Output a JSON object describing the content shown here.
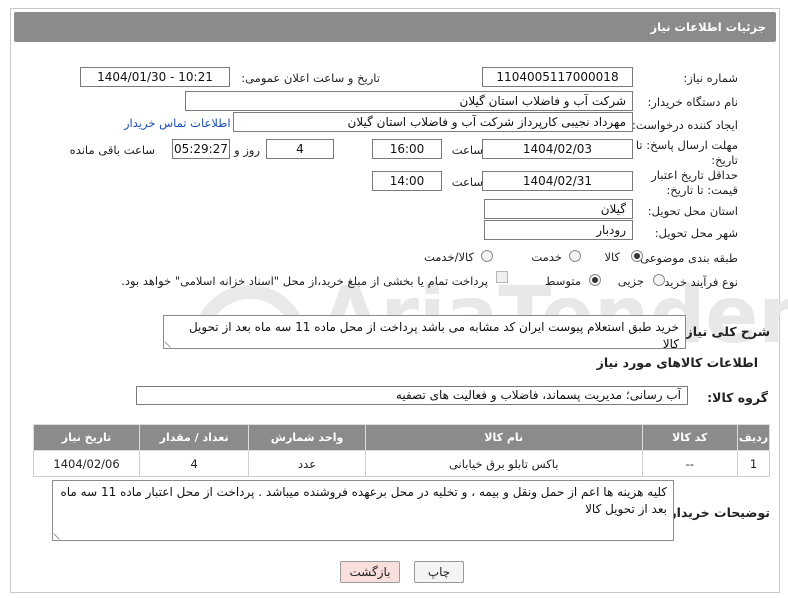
{
  "header": {
    "title": "جزئیات اطلاعات نیاز"
  },
  "form": {
    "need_number_label": "شماره نیاز:",
    "need_number": "1104005117000018",
    "announce_label": "تاریخ و ساعت اعلان عمومی:",
    "announce_value": "1404/01/30 - 10:21",
    "buyer_org_label": "نام دستگاه خریدار:",
    "buyer_org": "شرکت آب و فاضلاب استان گیلان",
    "creator_label": "ایجاد کننده درخواست:",
    "creator": "مهرداد نجیبی کارپرداز شرکت آب و فاضلاب استان گیلان",
    "contact_link": "اطلاعات تماس خریدار",
    "deadline_label": "مهلت ارسال پاسخ: تا تاریخ:",
    "deadline_date": "1404/02/03",
    "time_label": "ساعت",
    "deadline_time": "16:00",
    "days_value": "4",
    "days_label": "روز و",
    "remaining_time": "05:29:27",
    "remaining_label": "ساعت باقی مانده",
    "price_validity_label": "حداقل تاریخ اعتبار قیمت: تا تاریخ:",
    "validity_date": "1404/02/31",
    "validity_time": "14:00",
    "province_label": "استان محل تحویل:",
    "province": "گیلان",
    "city_label": "شهر محل تحویل:",
    "city": "رودبار",
    "category_label": "طبقه بندی موضوعی:",
    "category_options": [
      "کالا",
      "خدمت",
      "کالا/خدمت"
    ],
    "category_selected": "کالا",
    "process_label": "نوع فرآیند خرید :",
    "process_options": [
      "جزیی",
      "متوسط"
    ],
    "process_selected": "متوسط",
    "payment_note": "پرداخت تمام یا بخشی از مبلغ خرید،از محل \"اسناد خزانه اسلامی\" خواهد بود."
  },
  "description": {
    "label": "شرح کلی نیاز:",
    "text": "خرید طبق استعلام پیوست ایران کد مشابه می باشد پرداخت از محل ماده 11 سه ماه بعد از تحویل کالا"
  },
  "goods": {
    "section_title": "اطلاعات کالاهای مورد نیاز",
    "group_label": "گروه کالا:",
    "group_value": "آب رسانی؛ مدیریت پسماند، فاضلاب و فعالیت های تصفیه",
    "columns": [
      "ردیف",
      "کد کالا",
      "نام کالا",
      "واحد شمارش",
      "تعداد / مقدار",
      "تاریخ نیاز"
    ],
    "rows": [
      {
        "row": "1",
        "code": "--",
        "name": "باکس تابلو برق خیابانی",
        "unit": "عدد",
        "qty": "4",
        "date": "1404/02/06"
      }
    ]
  },
  "buyer_notes": {
    "label": "توضیحات خریدار:",
    "text": "کلیه هزینه ها اعم از حمل ونقل و بیمه ، و تخلیه در محل برعهده فروشنده میباشد . پرداخت از محل اعتبار ماده 11 سه ماه بعد از تحویل کالا"
  },
  "buttons": {
    "print": "چاپ",
    "back": "بازگشت"
  },
  "colors": {
    "header_bg": "#8b8b8b",
    "link": "#1a4fb5",
    "back_button_bg": "#f9dede",
    "watermark": "#e7e7e7"
  },
  "watermark": {
    "text": "AriaTender.neT"
  }
}
